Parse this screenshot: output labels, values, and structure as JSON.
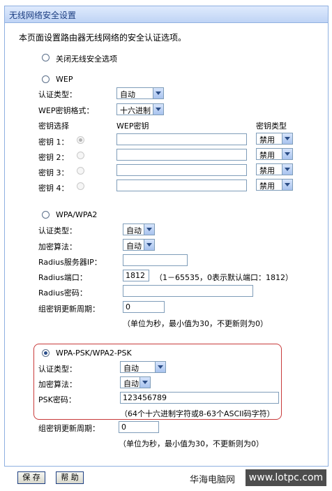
{
  "title": "无线网络安全设置",
  "intro": "本页面设置路由器无线网络的安全认证选项。",
  "options": {
    "disable": "关闭无线安全选项",
    "wep": "WEP",
    "wpa": "WPA/WPA2",
    "wpa_psk": "WPA-PSK/WPA2-PSK"
  },
  "wep": {
    "auth_label": "认证类型：",
    "auth_value": "自动",
    "format_label": "WEP密钥格式：",
    "format_value": "十六进制",
    "col_select": "密钥选择",
    "col_key": "WEP密钥",
    "col_type": "密钥类型",
    "keys": [
      {
        "label": "密钥 1：",
        "value": "",
        "type": "禁用"
      },
      {
        "label": "密钥 2：",
        "value": "",
        "type": "禁用"
      },
      {
        "label": "密钥 3：",
        "value": "",
        "type": "禁用"
      },
      {
        "label": "密钥 4：",
        "value": "",
        "type": "禁用"
      }
    ]
  },
  "wpa": {
    "auth_label": "认证类型：",
    "auth_value": "自动",
    "enc_label": "加密算法：",
    "enc_value": "自动",
    "radius_ip_label": "Radius服务器IP：",
    "radius_ip_value": "",
    "radius_port_label": "Radius端口：",
    "radius_port_value": "1812",
    "radius_port_hint": "（1－65535，0表示默认端口：1812）",
    "radius_pwd_label": "Radius密码：",
    "radius_pwd_value": "",
    "group_label": "组密钥更新周期：",
    "group_value": "0",
    "group_hint": "（单位为秒，最小值为30，不更新则为0）"
  },
  "psk": {
    "auth_label": "认证类型：",
    "auth_value": "自动",
    "enc_label": "加密算法：",
    "enc_value": "自动",
    "psk_label": "PSK密码：",
    "psk_value": "123456789",
    "psk_hint": "（64个十六进制字符或8-63个ASCII码字符）",
    "group_label": "组密钥更新周期：",
    "group_value": "0",
    "group_hint": "（单位为秒，最小值为30，不更新则为0）"
  },
  "buttons": {
    "save": "保 存",
    "help": "帮 助"
  },
  "watermark": {
    "cn": "华海电脑网",
    "url": "www.lotpc.com"
  },
  "colors": {
    "title_text": "#1a3c80",
    "highlight": "#c83a3a"
  }
}
